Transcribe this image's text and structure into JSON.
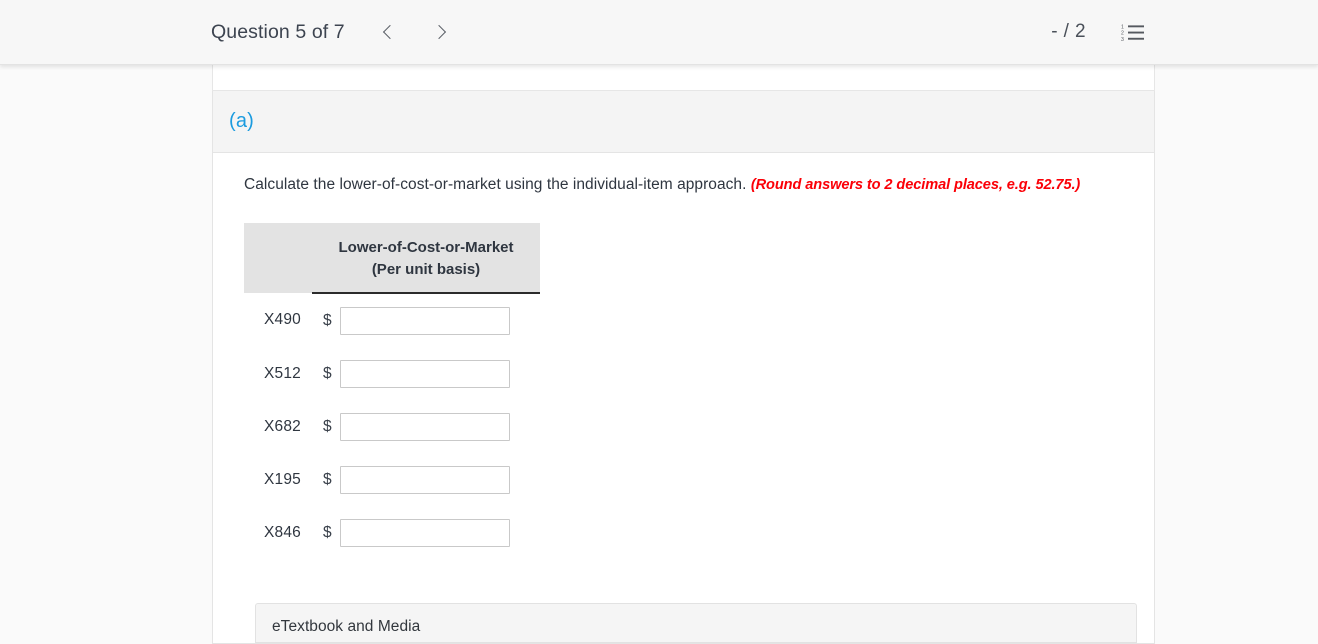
{
  "topbar": {
    "question_title": "Question 5 of 7",
    "prev_icon": "chevron-left-icon",
    "next_icon": "chevron-right-icon",
    "score": "- / 2",
    "list_icon": "numbered-list-icon",
    "list_digits": [
      "1",
      "2",
      "3"
    ]
  },
  "card": {
    "part_label": "(a)",
    "prompt_text": "Calculate the lower-of-cost-or-market using the individual-item approach.",
    "prompt_hint": "(Round answers to 2 decimal places, e.g. 52.75.)"
  },
  "table": {
    "corner_header": "",
    "column_header_line1": "Lower-of-Cost-or-Market",
    "column_header_line2": "(Per unit basis)",
    "currency_symbol": "$",
    "rows": [
      {
        "label": "X490",
        "currency": "$",
        "value": "",
        "placeholder": ""
      },
      {
        "label": "X512",
        "currency": "$",
        "value": "",
        "placeholder": ""
      },
      {
        "label": "X682",
        "currency": "$",
        "value": "",
        "placeholder": ""
      },
      {
        "label": "X195",
        "currency": "$",
        "value": "",
        "placeholder": ""
      },
      {
        "label": "X846",
        "currency": "$",
        "value": "",
        "placeholder": ""
      }
    ]
  },
  "etextbook": {
    "title": "eTextbook and Media"
  },
  "colors": {
    "accent_blue": "#1b9bdf",
    "hint_red": "#fb0007",
    "table_header_bg": "#e3e3e3",
    "page_bg": "#fafafa"
  }
}
